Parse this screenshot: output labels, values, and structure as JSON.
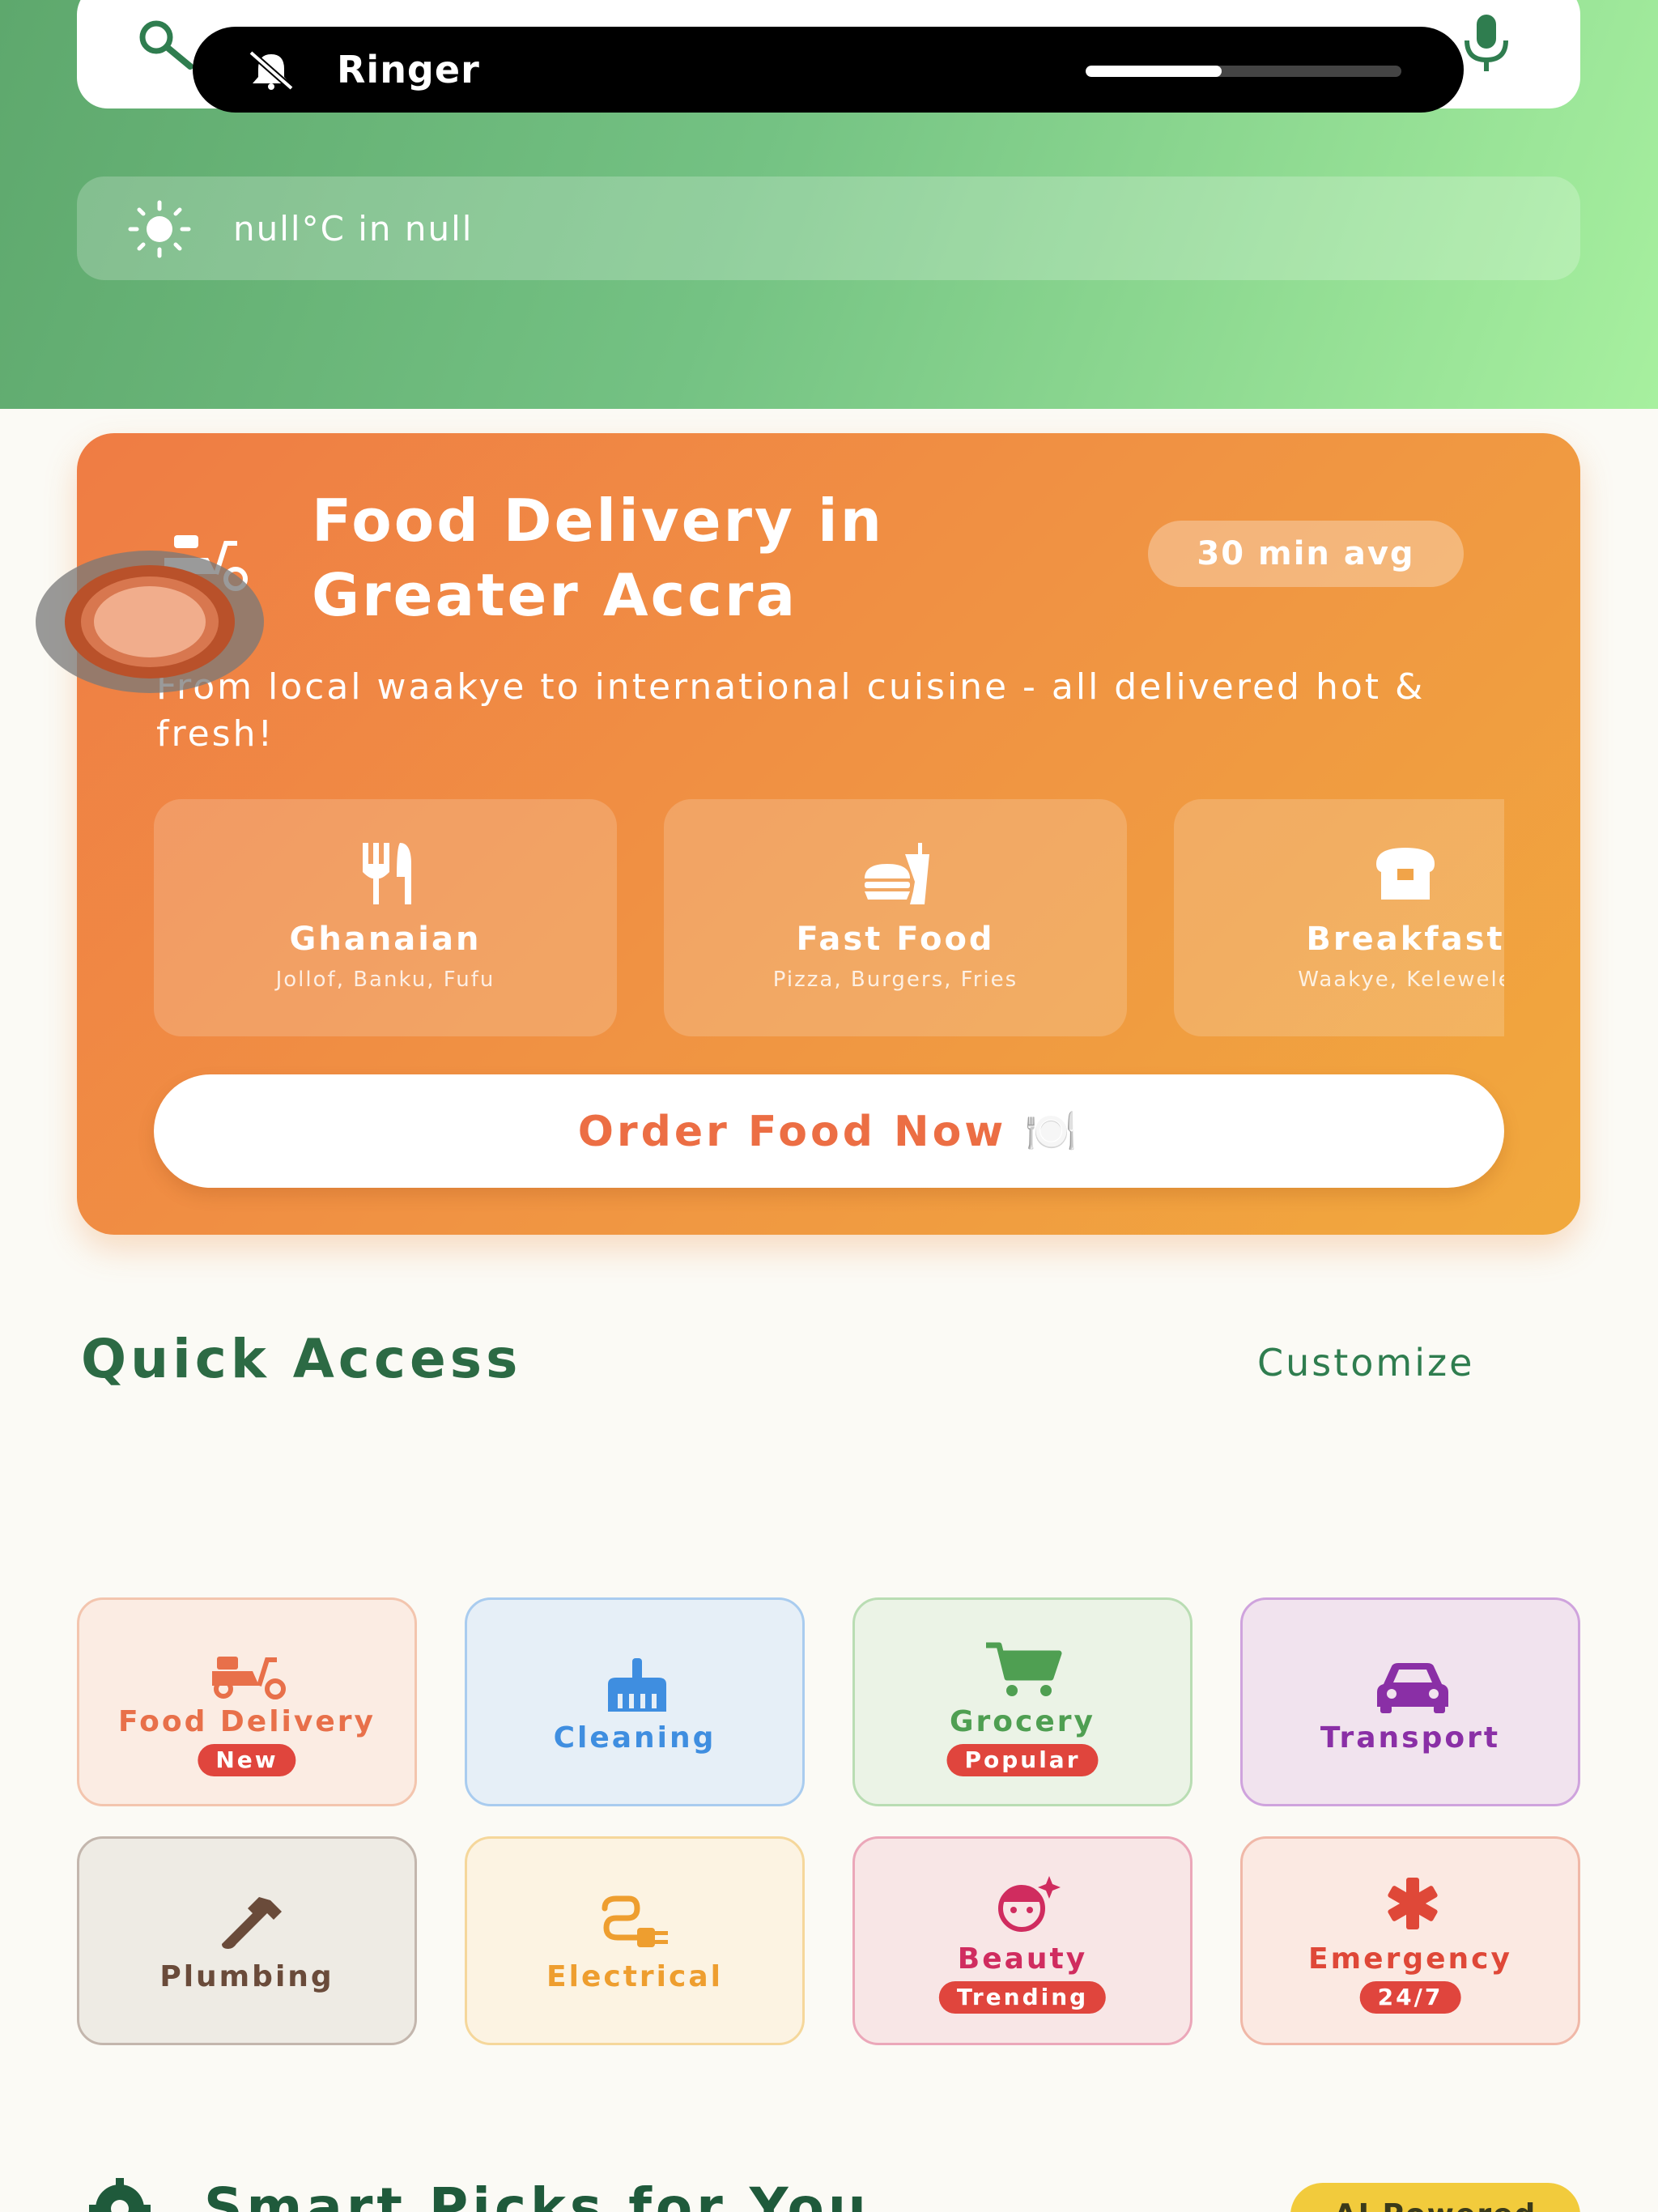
{
  "status_overlay": {
    "label": "Ringer",
    "level": 0.43,
    "icon": "bell-slash-icon"
  },
  "header": {
    "search_icon": "search-icon",
    "mic_icon": "microphone-icon",
    "weather_text": "null°C in null",
    "weather_icon": "sun-icon"
  },
  "food_card": {
    "title": "Food Delivery in Greater Accra",
    "badge": "30 min avg",
    "description": "From local waakye to international cuisine - all delivered hot & fresh!",
    "cuisines": [
      {
        "name": "Ghanaian",
        "sub": "Jollof, Banku, Fufu",
        "icon": "utensils-icon"
      },
      {
        "name": "Fast Food",
        "sub": "Pizza, Burgers, Fries",
        "icon": "burger-drink-icon"
      },
      {
        "name": "Breakfast",
        "sub": "Waakye, Kelewele",
        "icon": "bread-icon"
      }
    ],
    "cta": "Order Food Now 🍽️"
  },
  "quick_access": {
    "title": "Quick Access",
    "customize": "Customize",
    "tiles": [
      {
        "label": "Food Delivery",
        "badge": "New",
        "color": "#e8704a",
        "bg": "#fbece3",
        "border": "#f3c5ae",
        "icon": "scooter-icon"
      },
      {
        "label": "Cleaning",
        "badge": "",
        "color": "#3f8ee0",
        "bg": "#e6eff7",
        "border": "#a9ccef",
        "icon": "broom-icon"
      },
      {
        "label": "Grocery",
        "badge": "Popular",
        "color": "#4f9f52",
        "bg": "#ebf3e6",
        "border": "#b9ddb3",
        "icon": "cart-icon"
      },
      {
        "label": "Transport",
        "badge": "",
        "color": "#8a2fa6",
        "bg": "#f1e3ee",
        "border": "#cfa3dd",
        "icon": "car-icon"
      },
      {
        "label": "Plumbing",
        "badge": "",
        "color": "#6a4b3a",
        "bg": "#eeebe4",
        "border": "#c3b6ad",
        "icon": "wrench-icon"
      },
      {
        "label": "Electrical",
        "badge": "",
        "color": "#ee9e2f",
        "bg": "#fcf3e2",
        "border": "#f5d79b",
        "icon": "plug-icon"
      },
      {
        "label": "Beauty",
        "badge": "Trending",
        "color": "#d02c5f",
        "bg": "#f8e6e6",
        "border": "#eba7b9",
        "icon": "face-sparkle-icon"
      },
      {
        "label": "Emergency",
        "badge": "24/7",
        "color": "#df4838",
        "bg": "#fbe9e2",
        "border": "#f0b8a8",
        "icon": "asterisk-icon"
      }
    ]
  },
  "smart_picks": {
    "title": "Smart Picks for You",
    "badge": "AI Powered",
    "icon": "brain-gear-icon"
  }
}
